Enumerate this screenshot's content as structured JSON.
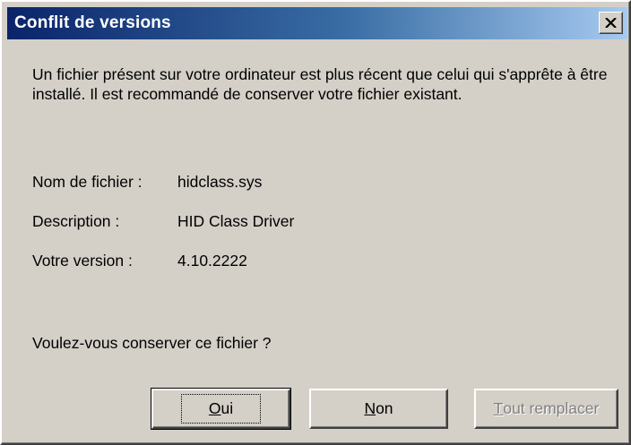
{
  "window": {
    "title": "Conflit de versions",
    "close_icon": "close-x-icon"
  },
  "message": "Un fichier présent sur votre ordinateur est plus récent que celui qui s'apprête à être installé. Il est recommandé de conserver votre fichier existant.",
  "details": {
    "filename_label": "Nom de fichier :",
    "filename_value": "hidclass.sys",
    "description_label": "Description :",
    "description_value": "HID Class Driver",
    "version_label": "Votre version :",
    "version_value": "4.10.2222"
  },
  "question": "Voulez-vous conserver ce fichier ?",
  "buttons": {
    "yes_mnemonic": "O",
    "yes_rest": "ui",
    "no_mnemonic": "N",
    "no_rest": "on",
    "replace_all_mnemonic": "T",
    "replace_all_rest": "out remplacer"
  },
  "colors": {
    "dialog_bg": "#d4d0c8",
    "title_start": "#0a246a",
    "title_end": "#a6caf0",
    "disabled_text": "#808080"
  }
}
